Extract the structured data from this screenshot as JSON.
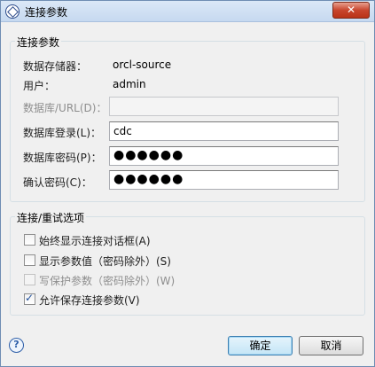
{
  "window": {
    "title": "连接参数",
    "close_symbol": "✕"
  },
  "connection_group": {
    "caption": "连接参数",
    "repository_label": "数据存储器：",
    "repository_value": "orcl-source",
    "user_label": "用户：",
    "user_value": "admin",
    "db_url_label": "数据库/URL(D)：",
    "db_url_value": "",
    "db_login_label": "数据库登录(L)：",
    "db_login_value": "cdc",
    "db_password_label": "数据库密码(P)：",
    "db_password_value": "●●●●●●",
    "confirm_password_label": "确认密码(C)：",
    "confirm_password_value": "●●●●●●"
  },
  "options_group": {
    "caption": "连接/重试选项",
    "options": [
      {
        "label": "始终显示连接对话框(A)",
        "checked": false,
        "enabled": true
      },
      {
        "label": "显示参数值（密码除外）(S)",
        "checked": false,
        "enabled": true
      },
      {
        "label": "写保护参数（密码除外）(W)",
        "checked": false,
        "enabled": false
      },
      {
        "label": "允许保存连接参数(V)",
        "checked": true,
        "enabled": true
      }
    ]
  },
  "footer": {
    "ok_label": "确定",
    "cancel_label": "取消",
    "help_icon": "help-icon"
  }
}
